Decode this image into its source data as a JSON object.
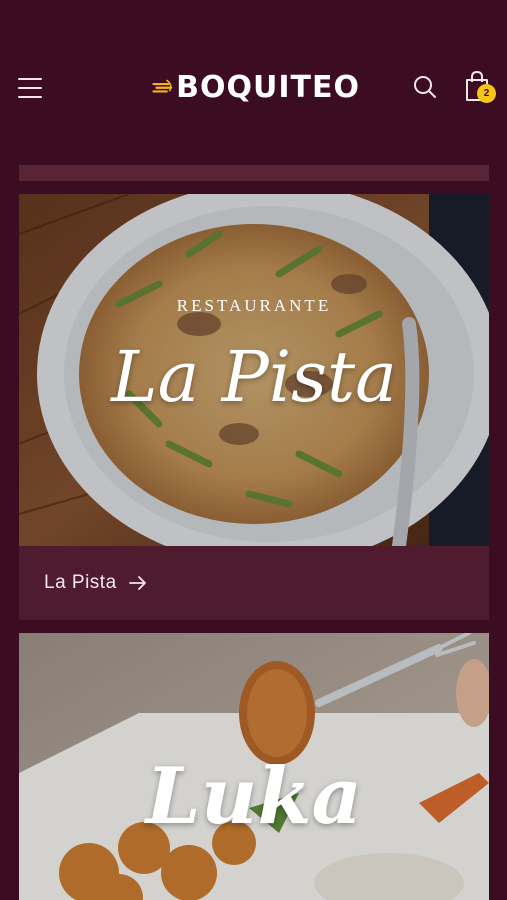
{
  "header": {
    "logo_text": "BOQUITEO",
    "menu_icon": "hamburger-menu-icon",
    "search_icon": "search-icon",
    "cart_icon": "shopping-bag-icon",
    "cart_count": "2"
  },
  "restaurants": [
    {
      "overlay_subtitle": "RESTAURANTE",
      "overlay_title": "La Pista",
      "link_label": "La Pista",
      "link_icon": "arrow-right-icon"
    },
    {
      "overlay_title": "Luka"
    }
  ],
  "colors": {
    "background": "#3b0c22",
    "card_footer": "#4f1b2e",
    "badge": "#f5c518",
    "logo_accent": "#f5b21b"
  }
}
